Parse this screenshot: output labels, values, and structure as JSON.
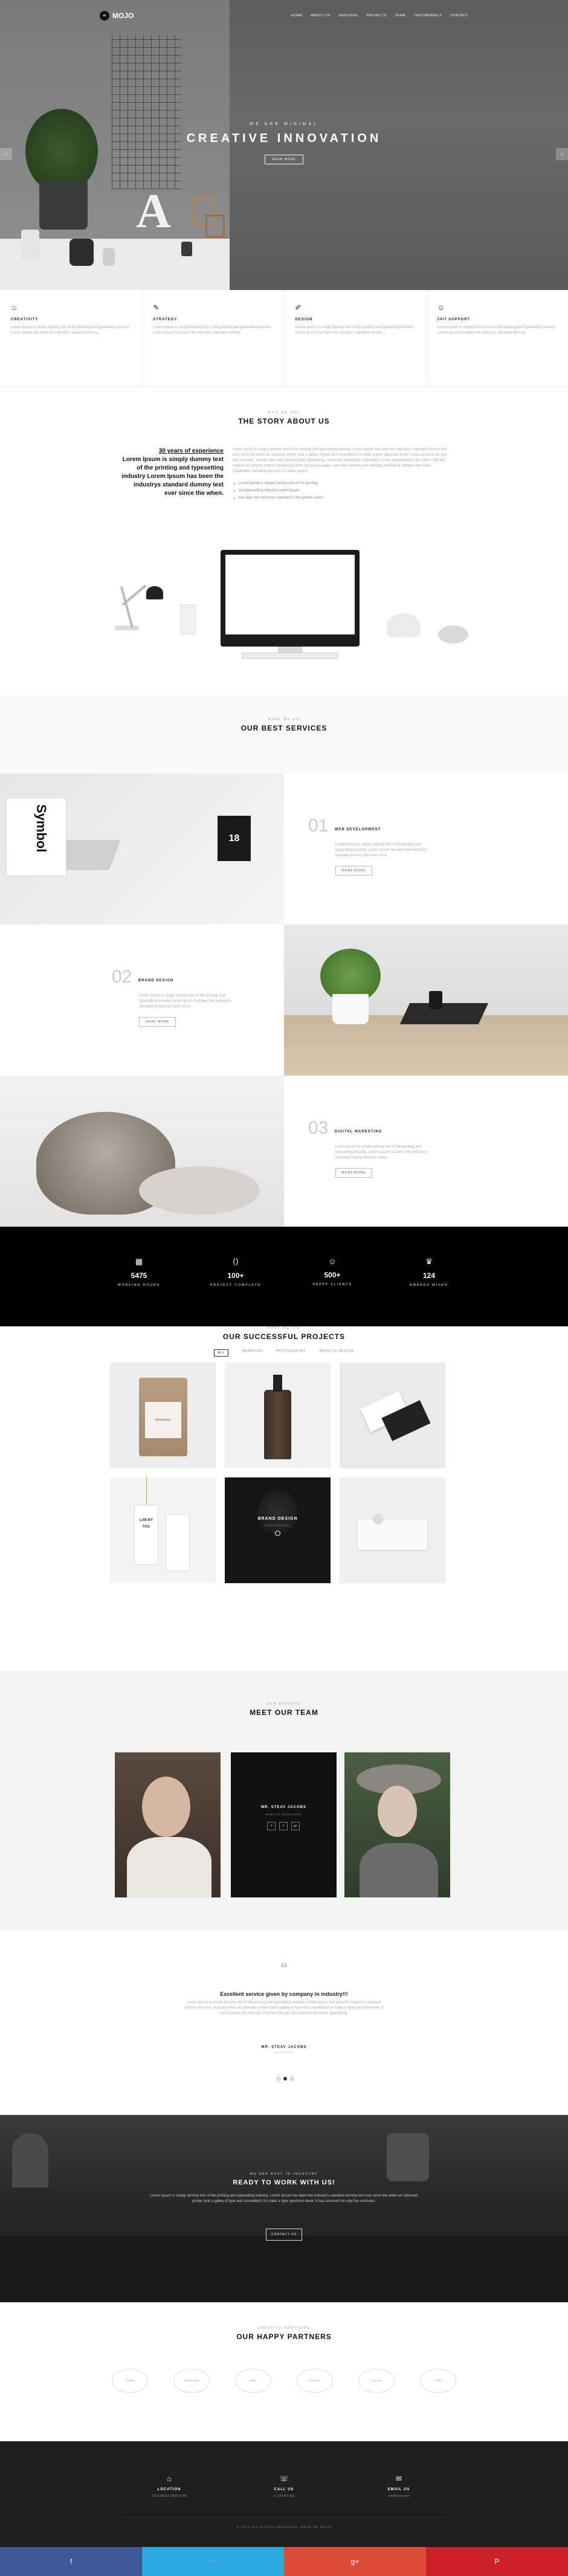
{
  "nav": {
    "logo_mark": "m",
    "logo_text": "MOJO",
    "items": [
      "HOME",
      "ABOUT US",
      "SERVICES",
      "PROJECTS",
      "TEAM",
      "TESTIMONIALS",
      "CONTACT"
    ]
  },
  "hero": {
    "subtitle": "WE ARE MINIMAL",
    "title": "CREATIVE INNOVATION",
    "button": "READ MORE",
    "arrow_left": "‹",
    "arrow_right": "›"
  },
  "features": [
    {
      "icon": "lightbulb-icon",
      "glyph": "♨",
      "title": "CREATIVITY",
      "text": "Lorem Ipsum is simply dummy text of the printing and typesetting industry Lorem Ipsum has been the industry's standard dummy."
    },
    {
      "icon": "megaphone-icon",
      "glyph": "✎",
      "title": "STRATEGY",
      "text": "Lorem Ipsum is simply dummy text of the printing and typesetting industry Lorem Ipsum has been the industry's standard dummy."
    },
    {
      "icon": "brush-icon",
      "glyph": "✐",
      "title": "DESIGN",
      "text": "Lorem Ipsum is simply dummy text of the printing and typesetting industry Lorem Ipsum has been the industry's standard dummy."
    },
    {
      "icon": "support-icon",
      "glyph": "☺",
      "title": "24/7 SUPPORT",
      "text": "Lorem Ipsum is simply dummy text of the printing and typesetting industry Lorem Ipsum has been the industry's standard dummy."
    }
  ],
  "story": {
    "label": "WHO WE ARE",
    "title": "THE STORY ABOUT US",
    "lead_years": "30 years of experience",
    "lead_rest": "Lorem Ipsum is simply dummy text of the printing and typesetting industry Lorem Ipsum has been the industrys standard dummy text ever since the when.",
    "paragraph": "Lorem Ipsum is simply dummy text of the printing and typesetting industry. Lorem Ipsum has been the industry's standard dummy text ever since the when an unknown printer took a galley of type and scrambled it to make a type specimen book. It has survived not only five centuries, but also the leap into electronic typesetting, remaining essentially unchanged. It was popularised in the 1960s with the release of Letraset sheets containing Lorem Ipsum passages, and more recently with desktop publishing software like Aldus PageMaker including versions of Lorem Ipsum.",
    "bullets": [
      "Lorem Ipsum is simply dummy text of the printing",
      "and typesetting industry Lorem Ipsum",
      "has been the industry's standard in the printer Lorem"
    ]
  },
  "services": {
    "label": "WHAT WE DO",
    "title": "OUR BEST SERVICES",
    "items": [
      {
        "num": "01",
        "title": "WEB DEVELOPMENT",
        "text": "Lorem Ipsum is simply dummy text of the printing and typesetting industry. Lorem Ipsum has been the industry's standard dummy text ever since.",
        "button": "READ MORE"
      },
      {
        "num": "02",
        "title": "BRAND DESIGN",
        "text": "Lorem Ipsum is simply dummy text of the printing and typesetting industry. Lorem Ipsum has been the industry's standard dummy text ever since.",
        "button": "READ MORE"
      },
      {
        "num": "03",
        "title": "DIGITAL MARKETING",
        "text": "Lorem Ipsum is simply dummy text of the printing and typesetting industry. Lorem Ipsum has been the industry's standard dummy text ever since.",
        "button": "READ MORE"
      }
    ],
    "photo_book": "Symbol",
    "photo_calendar": "18"
  },
  "stats": [
    {
      "icon": "calendar-icon",
      "glyph": "▦",
      "value": "5475",
      "label": "WORKING HOURS"
    },
    {
      "icon": "code-icon",
      "glyph": "⟨⟩",
      "value": "100+",
      "label": "PROJECT COMPLETE"
    },
    {
      "icon": "smile-icon",
      "glyph": "☺",
      "value": "500+",
      "label": "HAPPY CLIENTS"
    },
    {
      "icon": "trophy-icon",
      "glyph": "♛",
      "value": "124",
      "label": "AWARDS WINER"
    }
  ],
  "projects": {
    "label": "WHAT WE DID",
    "title": "OUR SUCCESSFUL PROJECTS",
    "filters": [
      "ALL",
      "BRANDING",
      "PHOTOGRAPHY",
      "WEBSITE DESIGN"
    ],
    "coffee_label": "Parisienne",
    "brand_title": "BRAND DESIGN",
    "brand_sub": "PHOTOGRAPHY",
    "tag_text": "LAB BY TAG"
  },
  "team": {
    "label": "OUR EXPERTS",
    "title": "MEET OUR TEAM",
    "member_name": "MR. STEAV JACOBS",
    "member_role": "WEBSITE DEVELOPER",
    "socials": [
      "f",
      "t",
      "g+"
    ]
  },
  "testimonial": {
    "quote_mark": "❝",
    "title": "Excellent service given by company in industry!!!",
    "text": "Lorem Ipsum is simply dummy text of the printing and typesetting industry. Lorem Ipsum has been the industry's standard dummy text ever since the when an unknown printer took a galley of type and scrambled it to make a type specimen book. It has survived not only five centuries, but also the leap into electronic typesetting.",
    "name": "MR. STEAV JACOBS",
    "role": "DEVELOPER"
  },
  "cta": {
    "label": "WE ARE BEST IN INDUSTRY",
    "title": "READY TO WORK WITH US!",
    "text": "Lorem Ipsum is simply dummy text of the printing and typesetting industry. Lorem Ipsum has been the industry's standard dummy text ever since the when an unknown printer took a galley of type and scrambled it to make a type specimen book. It has survived not only five centuries.",
    "button": "CONTACT US"
  },
  "partners": {
    "label": "CREATIVE PARTNERS",
    "title": "OUR HAPPY PARTNERS",
    "logos": [
      "Vintage",
      "Handcrafted",
      "Retro",
      "Mountain",
      "Unicorn",
      "Coffee"
    ]
  },
  "footer": [
    {
      "icon": "location-icon",
      "glyph": "⌂",
      "title": "LOCATION",
      "value": "123 STREET, NEW YORK"
    },
    {
      "icon": "phone-icon",
      "glyph": "☏",
      "title": "CALL US",
      "value": "+1 234 567 890"
    },
    {
      "icon": "mail-icon",
      "glyph": "✉",
      "title": "EMAIL US",
      "value": "info@mojo.com"
    }
  ],
  "copyright": "© 2016 ALL RIGHTS RESERVED. MADE BY MOJO",
  "share": [
    {
      "icon": "facebook-icon",
      "glyph": "f",
      "color": "#3b5998"
    },
    {
      "icon": "twitter-icon",
      "glyph": "🐦",
      "color": "#2aa9e0"
    },
    {
      "icon": "googleplus-icon",
      "glyph": "g+",
      "color": "#dc4a38"
    },
    {
      "icon": "pinterest-icon",
      "glyph": "P",
      "color": "#cb2027"
    }
  ]
}
